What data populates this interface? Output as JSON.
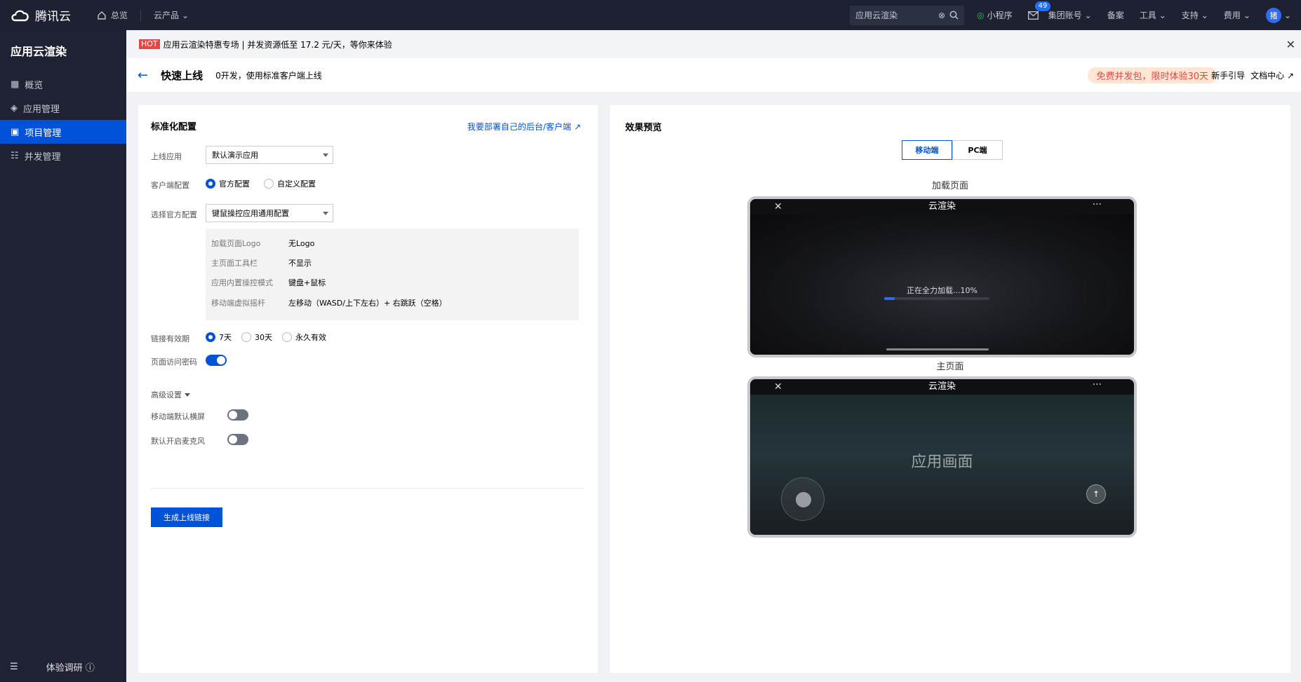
{
  "topbar": {
    "brand": "腾讯云",
    "home": "总览",
    "products": "云产品",
    "search_value": "应用云渲染",
    "miniprogram": "小程序",
    "mail_badge": "49",
    "account": "集团账号",
    "beian": "备案",
    "tools": "工具",
    "support": "支持",
    "billing": "费用",
    "avatar": "猪"
  },
  "sidebar": {
    "title": "应用云渲染",
    "items": [
      {
        "label": "概览",
        "icon": "grid-icon"
      },
      {
        "label": "应用管理",
        "icon": "layers-icon"
      },
      {
        "label": "项目管理",
        "icon": "folder-icon",
        "active": true
      },
      {
        "label": "并发管理",
        "icon": "list-icon"
      }
    ],
    "bottom_label": "体验调研"
  },
  "banner": {
    "hot": "HOT",
    "text": "应用云渲染特惠专场 | 并发资源低至 17.2 元/天，等你来体验"
  },
  "header": {
    "title": "快速上线",
    "subtitle": "0开发，使用标准客户端上线",
    "promo": "免费并发包，限时体验30天",
    "guide": "新手引导",
    "docs": "文档中心"
  },
  "config": {
    "title": "标准化配置",
    "deploy_link": "我要部署自己的后台/客户端",
    "app_label": "上线应用",
    "app_value": "默认演示应用",
    "client_label": "客户端配置",
    "client_opt1": "官方配置",
    "client_opt2": "自定义配置",
    "official_label": "选择官方配置",
    "official_value": "键鼠操控应用通用配置",
    "details": [
      {
        "key": "加载页面Logo",
        "value": "无Logo"
      },
      {
        "key": "主页面工具栏",
        "value": "不显示"
      },
      {
        "key": "应用内置操控模式",
        "value": "键盘+鼠标"
      },
      {
        "key": "移动端虚拟摇杆",
        "value": "左移动（WASD/上下左右）+ 右跳跃（空格）"
      }
    ],
    "validity_label": "链接有效期",
    "validity_opts": [
      "7天",
      "30天",
      "永久有效"
    ],
    "password_label": "页面访问密码",
    "password_on": true,
    "advanced": "高级设置",
    "landscape_label": "移动端默认横屏",
    "landscape_on": false,
    "mic_label": "默认开启麦克风",
    "mic_on": false,
    "generate_button": "生成上线链接"
  },
  "preview": {
    "title": "效果预览",
    "tab_mobile": "移动端",
    "tab_pc": "PC端",
    "loading_label": "加载页面",
    "main_label": "主页面",
    "phone_title": "云渲染",
    "loading_text": "正在全力加载...10%",
    "loading_progress": 0.1,
    "app_placeholder": "应用画面"
  }
}
